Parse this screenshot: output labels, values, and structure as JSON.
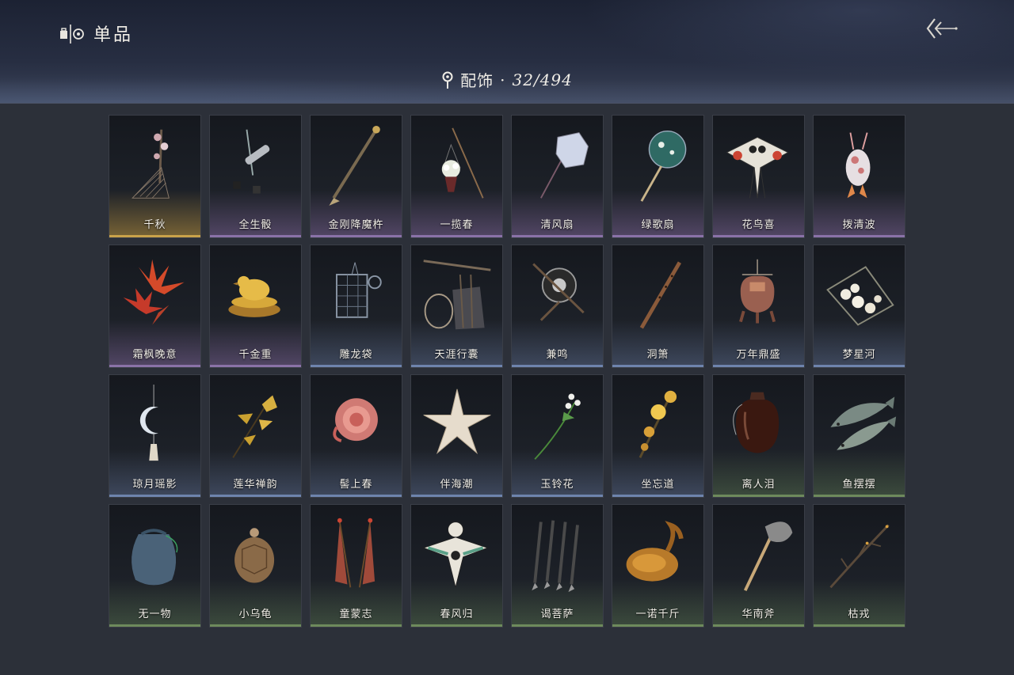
{
  "header": {
    "title": "单品",
    "category_label": "配饰",
    "separator": "·",
    "count": "32/494"
  },
  "icons": {
    "title_icon": "collection-icon",
    "back_icon": "double-chevron-left-icon",
    "location_icon": "map-pin-icon"
  },
  "rarity_colors": {
    "gold": "#c9a24a",
    "purple": "#8a72a8",
    "blue": "#6e84ad",
    "green": "#6e8a5c"
  },
  "items": [
    {
      "name": "千秋",
      "rarity": "gold",
      "icon": "plum-branch-harp-icon"
    },
    {
      "name": "全生骰",
      "rarity": "purple",
      "icon": "dice-staff-icon"
    },
    {
      "name": "金刚降魔杵",
      "rarity": "purple",
      "icon": "vajra-spear-icon"
    },
    {
      "name": "一揽春",
      "rarity": "purple",
      "icon": "flower-basket-pole-icon"
    },
    {
      "name": "清风扇",
      "rarity": "purple",
      "icon": "round-fan-icon"
    },
    {
      "name": "绿歌扇",
      "rarity": "purple",
      "icon": "green-fan-icon"
    },
    {
      "name": "花鸟喜",
      "rarity": "purple",
      "icon": "owl-kite-icon"
    },
    {
      "name": "拨清波",
      "rarity": "purple",
      "icon": "goose-toy-icon"
    },
    {
      "name": "霜枫晚意",
      "rarity": "purple",
      "icon": "maple-leaves-icon"
    },
    {
      "name": "千金重",
      "rarity": "purple",
      "icon": "golden-bird-icon"
    },
    {
      "name": "雕龙袋",
      "rarity": "blue",
      "icon": "carved-pouch-icon"
    },
    {
      "name": "天涯行囊",
      "rarity": "blue",
      "icon": "travel-pack-icon"
    },
    {
      "name": "兼鸣",
      "rarity": "blue",
      "icon": "gong-staff-icon"
    },
    {
      "name": "洞箫",
      "rarity": "blue",
      "icon": "flute-icon"
    },
    {
      "name": "万年鼎盛",
      "rarity": "blue",
      "icon": "tripod-cauldron-icon"
    },
    {
      "name": "梦星河",
      "rarity": "blue",
      "icon": "flower-swing-icon"
    },
    {
      "name": "琼月瑶影",
      "rarity": "blue",
      "icon": "crescent-pendant-icon"
    },
    {
      "name": "莲华禅韵",
      "rarity": "blue",
      "icon": "golden-lotus-branch-icon"
    },
    {
      "name": "髻上春",
      "rarity": "blue",
      "icon": "pink-peony-icon"
    },
    {
      "name": "伴海潮",
      "rarity": "blue",
      "icon": "starfish-icon"
    },
    {
      "name": "玉铃花",
      "rarity": "blue",
      "icon": "lily-of-valley-icon"
    },
    {
      "name": "坐忘道",
      "rarity": "blue",
      "icon": "gold-flower-branch-icon"
    },
    {
      "name": "离人泪",
      "rarity": "green",
      "icon": "wine-jar-icon"
    },
    {
      "name": "鱼摆摆",
      "rarity": "green",
      "icon": "fish-pair-icon"
    },
    {
      "name": "无一物",
      "rarity": "green",
      "icon": "cloth-sack-icon"
    },
    {
      "name": "小乌龟",
      "rarity": "green",
      "icon": "turtle-icon"
    },
    {
      "name": "童蒙志",
      "rarity": "green",
      "icon": "feather-flags-icon"
    },
    {
      "name": "春风归",
      "rarity": "green",
      "icon": "swallow-kite-icon"
    },
    {
      "name": "谒菩萨",
      "rarity": "green",
      "icon": "darts-bundle-icon"
    },
    {
      "name": "一诺千斤",
      "rarity": "green",
      "icon": "roast-chicken-icon"
    },
    {
      "name": "华南斧",
      "rarity": "green",
      "icon": "axe-icon"
    },
    {
      "name": "枯戎",
      "rarity": "green",
      "icon": "dry-branch-icon"
    }
  ]
}
